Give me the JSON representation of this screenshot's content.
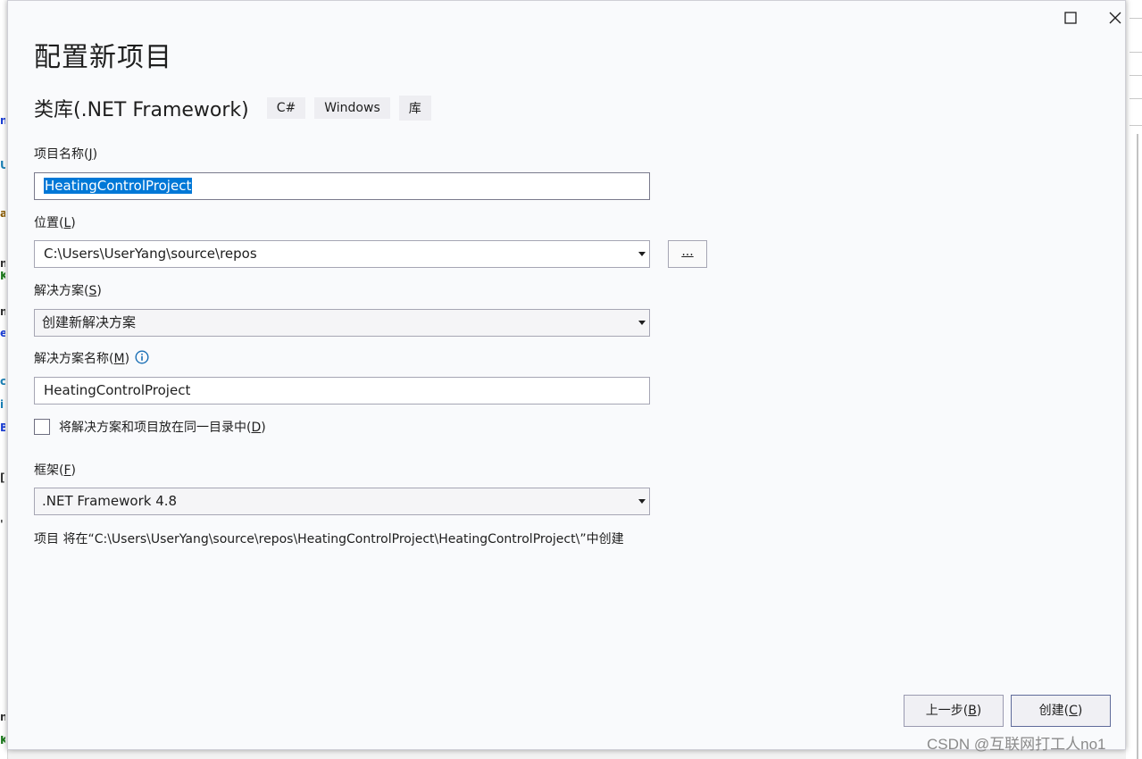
{
  "dialog": {
    "title": "配置新项目",
    "template": {
      "name": "类库(.NET Framework)",
      "tags": [
        "C#",
        "Windows",
        "库"
      ]
    },
    "project_name": {
      "label": "项目名称(",
      "hotkey": "J",
      "label_end": ")",
      "value": "HeatingControlProject"
    },
    "location": {
      "label": "位置(",
      "hotkey": "L",
      "label_end": ")",
      "value": "C:\\Users\\UserYang\\source\\repos",
      "browse_label": "..."
    },
    "solution": {
      "label": "解决方案(",
      "hotkey": "S",
      "label_end": ")",
      "value": "创建新解决方案"
    },
    "solution_name": {
      "label": "解决方案名称(",
      "hotkey": "M",
      "label_end": ")",
      "value": "HeatingControlProject"
    },
    "same_directory": {
      "label": "将解决方案和项目放在同一目录中(",
      "hotkey": "D",
      "label_end": ")",
      "checked": false
    },
    "framework": {
      "label": "框架(",
      "hotkey": "F",
      "label_end": ")",
      "value": ".NET Framework 4.8"
    },
    "path_info": "项目 将在“C:\\Users\\UserYang\\source\\repos\\HeatingControlProject\\HeatingControlProject\\”中创建",
    "buttons": {
      "back": {
        "label": "上一步(",
        "hotkey": "B",
        "label_end": ")"
      },
      "create": {
        "label": "创建(",
        "hotkey": "C",
        "label_end": ")"
      }
    }
  },
  "watermark": "CSDN @互联网打工人no1",
  "colors": {
    "selection": "#0078d7",
    "info_icon": "#1a6fb5",
    "dialog_bg": "#f9fafc"
  }
}
